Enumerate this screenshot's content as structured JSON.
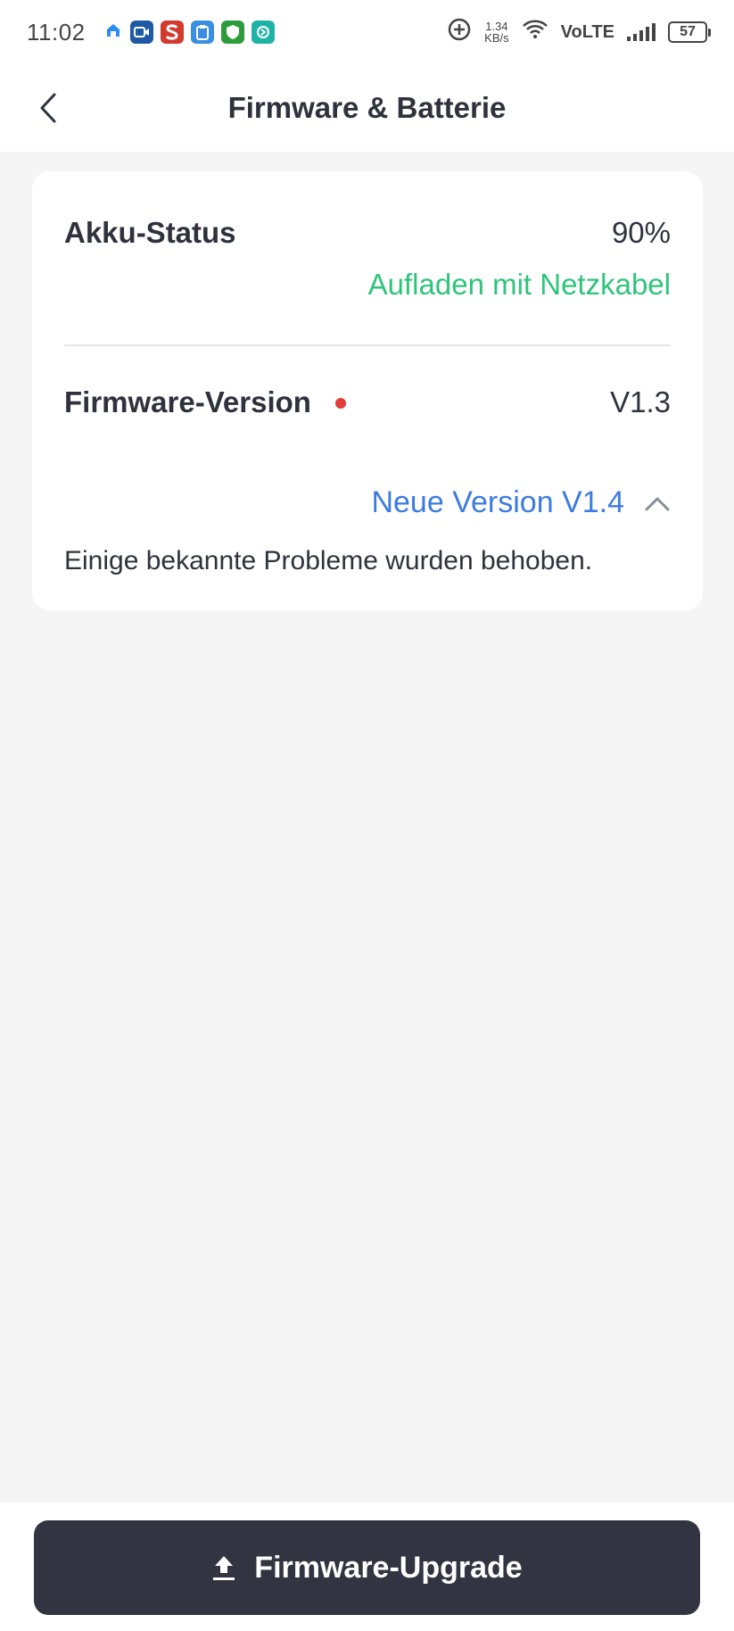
{
  "status_bar": {
    "time": "11:02",
    "net_speed_value": "1.34",
    "net_speed_unit": "KB/s",
    "network_label": "VoLTE",
    "battery_level": "57"
  },
  "header": {
    "title": "Firmware & Batterie"
  },
  "battery_section": {
    "label": "Akku-Status",
    "value": "90%",
    "charging_status": "Aufladen mit Netzkabel"
  },
  "firmware_section": {
    "label": "Firmware-Version",
    "current_version": "V1.3",
    "new_version_label": "Neue Version V1.4",
    "release_notes": "Einige bekannte Probleme wurden behoben."
  },
  "footer": {
    "upgrade_button_label": "Firmware-Upgrade"
  },
  "colors": {
    "charging_green": "#2fc57a",
    "link_blue": "#3d7be0",
    "update_dot_red": "#e23b3b",
    "button_dark": "#323541"
  }
}
